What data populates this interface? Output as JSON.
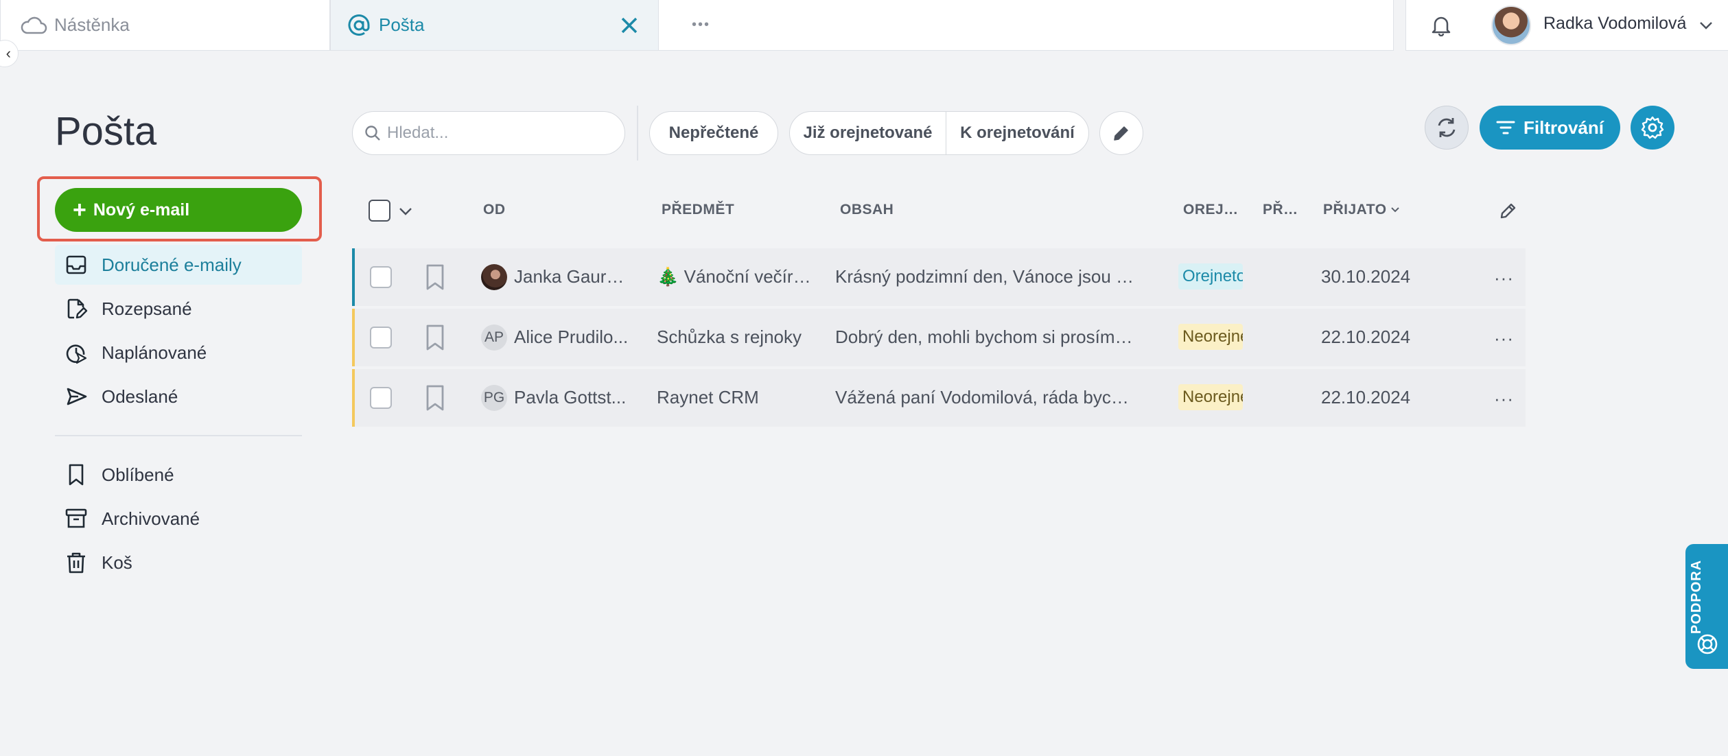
{
  "tabs": {
    "dashboard": "Nástěnka",
    "mail": "Pošta",
    "more": "•••"
  },
  "user": {
    "name": "Radka Vodomilová"
  },
  "sidebar": {
    "title": "Pošta",
    "new_email": "Nový e-mail",
    "folders": [
      {
        "label": "Doručené e-maily",
        "icon": "inbox-icon"
      },
      {
        "label": "Rozepsané",
        "icon": "draft-icon"
      },
      {
        "label": "Naplánované",
        "icon": "scheduled-icon"
      },
      {
        "label": "Odeslané",
        "icon": "send-icon"
      }
    ],
    "extra": [
      {
        "label": "Oblíbené",
        "icon": "bookmark-icon"
      },
      {
        "label": "Archivované",
        "icon": "archive-icon"
      },
      {
        "label": "Koš",
        "icon": "trash-icon"
      }
    ]
  },
  "toolbar": {
    "search_placeholder": "Hledat...",
    "filter_unread": "Nepřečtené",
    "filter_routed": "Již orejnetované",
    "filter_to_route": "K orejnetování",
    "filter_button": "Filtrování"
  },
  "table": {
    "headers": {
      "from": "OD",
      "subject": "PŘEDMĚT",
      "content": "OBSAH",
      "routed": "OREJ…",
      "pr": "PŘ…",
      "received": "PŘIJATO"
    },
    "rows": [
      {
        "initials": "",
        "from": "Janka Gauro...",
        "subject": "🎄 Vánoční večíre...",
        "content": "Krásný podzimní den, Vánoce jsou za ...",
        "status": "Orejnetováno",
        "date": "30.10.2024"
      },
      {
        "initials": "AP",
        "from": "Alice Prudilo...",
        "subject": "Schůzka s rejnoky",
        "content": "Dobrý den, mohli bychom si prosím do...",
        "status": "Neorejnetováno",
        "date": "22.10.2024"
      },
      {
        "initials": "PG",
        "from": "Pavla Gottst...",
        "subject": "Raynet CRM",
        "content": "Vážená paní Vodomilová, ráda bych V...",
        "status": "Neorejnetováno",
        "date": "22.10.2024"
      }
    ],
    "row_menu": "···"
  },
  "support": {
    "label": "PODPORA"
  },
  "colors": {
    "accent": "#1a95c2",
    "primary_green": "#3aa20f",
    "highlight": "#e35d4c"
  }
}
